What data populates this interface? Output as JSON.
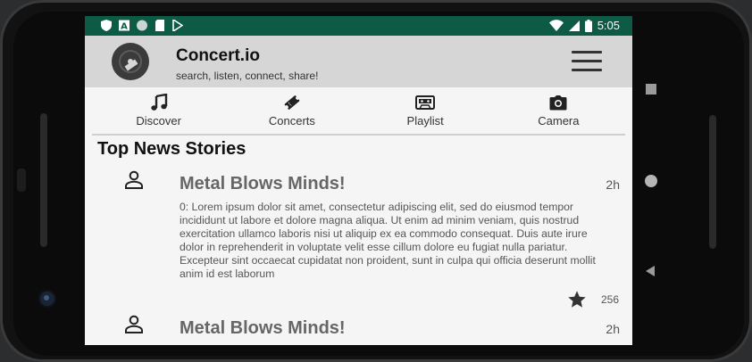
{
  "status_bar": {
    "time": "5:05",
    "left_icons": [
      "shield-icon",
      "app-a-icon",
      "circle-icon",
      "sd-card-icon",
      "play-store-icon"
    ],
    "right_icons": [
      "wifi-icon",
      "signal-icon",
      "battery-icon"
    ]
  },
  "app": {
    "title": "Concert.io",
    "subtitle": "search, listen, connect, share!"
  },
  "tabs": [
    {
      "label": "Discover",
      "icon": "music-note-icon"
    },
    {
      "label": "Concerts",
      "icon": "ticket-icon"
    },
    {
      "label": "Playlist",
      "icon": "cassette-icon"
    },
    {
      "label": "Camera",
      "icon": "camera-icon"
    }
  ],
  "section_title": "Top News Stories",
  "stories": [
    {
      "title": "Metal Blows Minds!",
      "time": "2h",
      "body": "0: Lorem ipsum dolor sit amet, consectetur adipiscing elit, sed do eiusmod tempor incididunt ut labore et dolore magna aliqua. Ut enim ad minim veniam, quis nostrud exercitation ullamco laboris nisi ut aliquip ex ea commodo consequat. Duis aute irure dolor in reprehenderit in voluptate velit esse cillum dolore eu fugiat nulla pariatur. Excepteur sint occaecat cupidatat non proident, sunt in culpa qui officia deserunt mollit anim id est laborum",
      "likes": "256"
    },
    {
      "title": "Metal Blows Minds!",
      "time": "2h"
    }
  ],
  "colors": {
    "status_bar": "#0d5a45",
    "app_bar": "#d6d6d6",
    "background": "#f5f5f5"
  }
}
